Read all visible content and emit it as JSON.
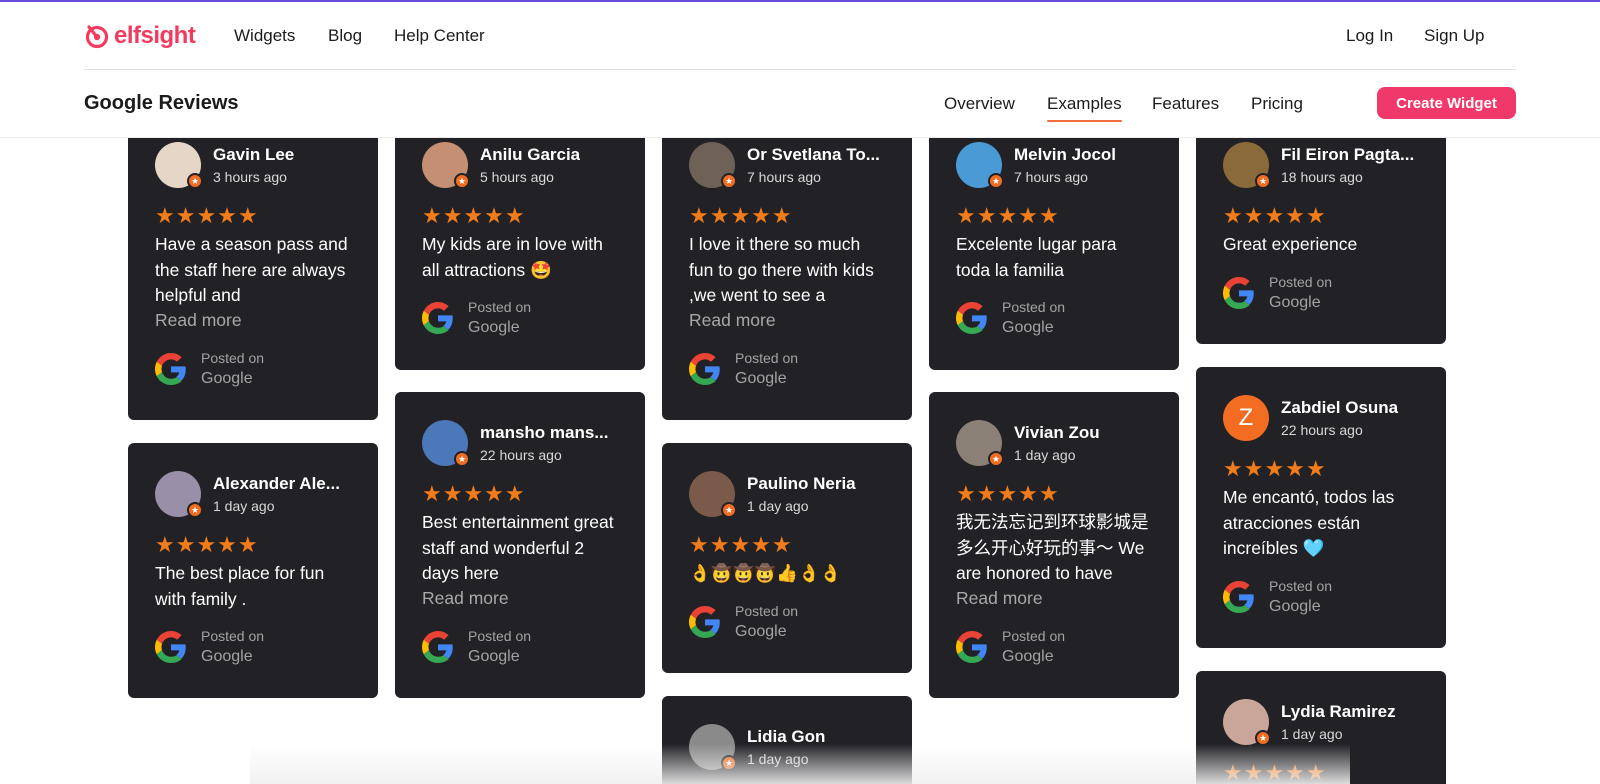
{
  "brand": {
    "name": "elfsight",
    "color": "#f23b5f"
  },
  "topnav": {
    "links": [
      "Widgets",
      "Blog",
      "Help Center"
    ],
    "login": "Log In",
    "signup": "Sign Up"
  },
  "subnav": {
    "title": "Google Reviews",
    "tabs": [
      "Overview",
      "Examples",
      "Features",
      "Pricing"
    ],
    "active_tab": "Examples",
    "cta": "Create Widget"
  },
  "source": {
    "posted_on": "Posted on",
    "platform": "Google"
  },
  "read_more": "Read more",
  "stars": "★★★★★",
  "reviews": [
    {
      "name": "Gavin Lee",
      "time": "3 hours ago",
      "text": "Have a season pass and the staff here are always helpful and",
      "truncated": true,
      "avatar_color": "#e6d6c8"
    },
    {
      "name": "Alexander Ale...",
      "time": "1 day ago",
      "text": "The best place for fun with family .",
      "truncated": false,
      "avatar_color": "#9a8fa8"
    },
    {
      "name": "Anilu Garcia",
      "time": "5 hours ago",
      "text": "My kids are in love with all attractions 🤩",
      "truncated": false,
      "avatar_color": "#c48f72"
    },
    {
      "name": "mansho mans...",
      "time": "22 hours ago",
      "text": "Best entertainment great staff and wonderful 2 days here",
      "truncated": true,
      "avatar_color": "#4b78b8"
    },
    {
      "name": "Or Svetlana To...",
      "time": "7 hours ago",
      "text": "I love it there so much fun to go there with kids ,we went to see a",
      "truncated": true,
      "avatar_color": "#6e6256"
    },
    {
      "name": "Paulino Neria",
      "time": "1 day ago",
      "text": "👌🤠🤠🤠👍👌👌",
      "truncated": false,
      "avatar_color": "#7a5a4a"
    },
    {
      "name": "Lidia Gon",
      "time": "1 day ago",
      "text": "",
      "truncated": false,
      "avatar_color": "#8a8a8a"
    },
    {
      "name": "Melvin Jocol",
      "time": "7 hours ago",
      "text": "Excelente lugar para toda la familia",
      "truncated": false,
      "avatar_color": "#4a9ad6"
    },
    {
      "name": "Vivian Zou",
      "time": "1 day ago",
      "text": "我无法忘记到环球影城是多么开心好玩的事～ We are honored to have",
      "truncated": true,
      "avatar_color": "#8b8076"
    },
    {
      "name": "Fil Eiron Pagta...",
      "time": "18 hours ago",
      "text": "Great experience",
      "truncated": false,
      "avatar_color": "#8a6a3a"
    },
    {
      "name": "Zabdiel Osuna",
      "time": "22 hours ago",
      "text": "Me encantó, todos las atracciones están increíbles 🩵",
      "truncated": false,
      "avatar_color": "#f26d21",
      "avatar_letter": "Z"
    },
    {
      "name": "Lydia Ramirez",
      "time": "1 day ago",
      "text": "",
      "truncated": false,
      "avatar_color": "#c9a59a"
    }
  ]
}
